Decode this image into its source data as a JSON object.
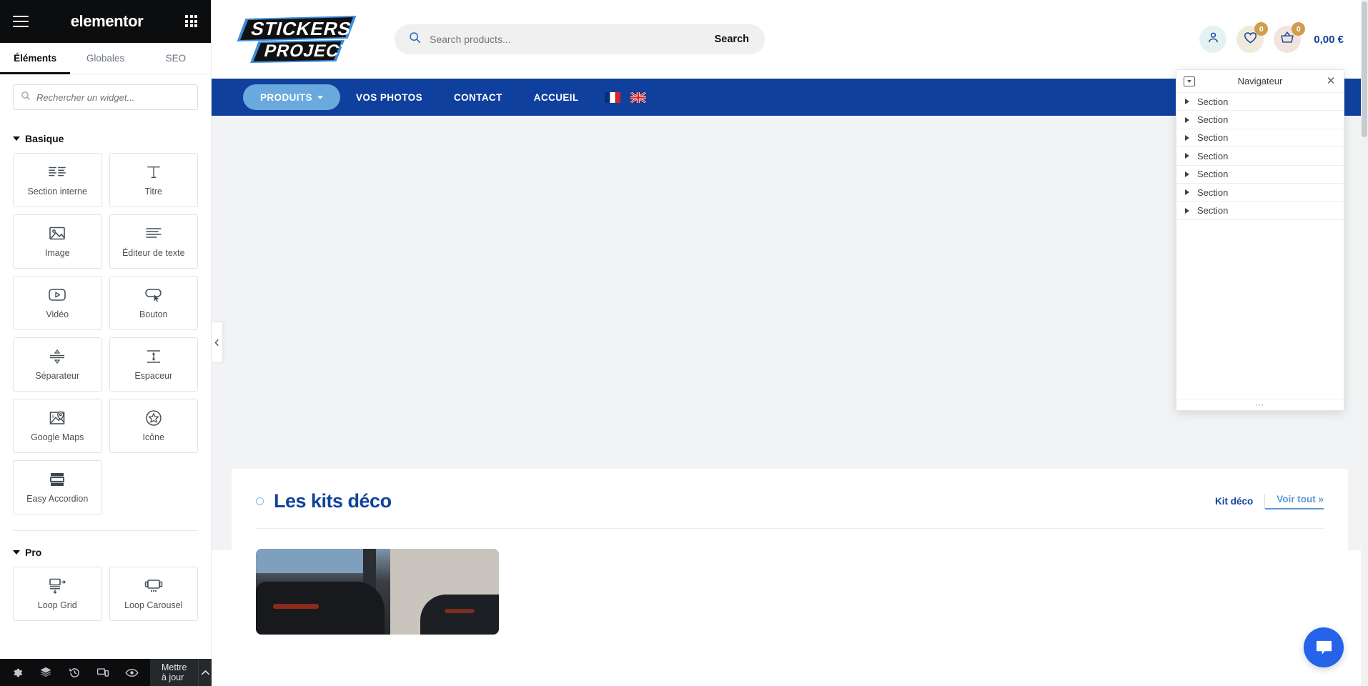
{
  "editor": {
    "brand": "elementor",
    "menu_icon": "hamburger-icon",
    "apps_icon": "apps-grid-icon",
    "tabs": [
      {
        "label": "Éléments",
        "active": true
      },
      {
        "label": "Globales",
        "active": false
      },
      {
        "label": "SEO",
        "active": false
      }
    ],
    "search": {
      "placeholder": "Rechercher un widget...",
      "value": "",
      "icon": "search-icon"
    },
    "categories": [
      {
        "title": "Basique",
        "widgets": [
          {
            "label": "Section interne",
            "icon": "inner-section-icon"
          },
          {
            "label": "Titre",
            "icon": "heading-icon"
          },
          {
            "label": "Image",
            "icon": "image-icon"
          },
          {
            "label": "Éditeur de texte",
            "icon": "text-editor-icon"
          },
          {
            "label": "Vidéo",
            "icon": "video-icon"
          },
          {
            "label": "Bouton",
            "icon": "button-icon"
          },
          {
            "label": "Séparateur",
            "icon": "divider-icon"
          },
          {
            "label": "Espaceur",
            "icon": "spacer-icon"
          },
          {
            "label": "Google Maps",
            "icon": "google-maps-icon"
          },
          {
            "label": "Icône",
            "icon": "star-icon"
          },
          {
            "label": "Easy Accordion",
            "icon": "accordion-icon"
          }
        ]
      },
      {
        "title": "Pro",
        "widgets": [
          {
            "label": "Loop Grid",
            "icon": "loop-grid-icon"
          },
          {
            "label": "Loop Carousel",
            "icon": "loop-carousel-icon"
          }
        ]
      }
    ],
    "bottombar": {
      "icons": [
        {
          "name": "settings-gear-icon",
          "title": "Réglages"
        },
        {
          "name": "layers-icon",
          "title": "Navigateur"
        },
        {
          "name": "history-icon",
          "title": "Historique"
        },
        {
          "name": "responsive-icon",
          "title": "Mode responsive"
        },
        {
          "name": "preview-eye-icon",
          "title": "Aperçu"
        }
      ],
      "update_label": "Mettre à jour",
      "caret_icon": "chevron-up-icon"
    },
    "collapse_handle_icon": "chevron-left-icon"
  },
  "navigator": {
    "title": "Navigateur",
    "dock_icon": "dock-icon",
    "close_icon": "close-icon",
    "resize_icon": "resize-dots-icon",
    "items": [
      {
        "label": "Section"
      },
      {
        "label": "Section"
      },
      {
        "label": "Section"
      },
      {
        "label": "Section"
      },
      {
        "label": "Section"
      },
      {
        "label": "Section"
      },
      {
        "label": "Section"
      }
    ]
  },
  "site": {
    "logo": {
      "line1": "STICKERS",
      "line2": "PROJECT",
      "alt": "Stickers Project logo"
    },
    "search": {
      "placeholder": "Search products...",
      "value": "",
      "button_label": "Search",
      "icon": "search-icon"
    },
    "header_actions": {
      "account": {
        "icon": "user-icon"
      },
      "wishlist": {
        "icon": "heart-icon",
        "count": "0"
      },
      "cart": {
        "icon": "basket-icon",
        "count": "0",
        "total": "0,00 €"
      }
    },
    "nav": [
      {
        "label": "PRODUITS",
        "has_dropdown": true,
        "active": true
      },
      {
        "label": "VOS PHOTOS",
        "has_dropdown": false,
        "active": false
      },
      {
        "label": "CONTACT",
        "has_dropdown": false,
        "active": false
      },
      {
        "label": "ACCUEIL",
        "has_dropdown": false,
        "active": false
      }
    ],
    "languages": [
      {
        "name": "flag-fr-icon",
        "label": "Français"
      },
      {
        "name": "flag-en-icon",
        "label": "English"
      }
    ],
    "section": {
      "title": "Les kits déco",
      "filter_label": "Kit déco",
      "see_all_label": "Voir tout »"
    },
    "chat": {
      "icon": "chat-bubble-icon"
    }
  },
  "colors": {
    "brand_blue": "#10409e",
    "nav_pill": "#6aa9dd",
    "badge": "#cf9d4e",
    "accent_link": "#5b9bd5",
    "editor_dark": "#0c0d0e",
    "chat_blue": "#2563eb"
  }
}
